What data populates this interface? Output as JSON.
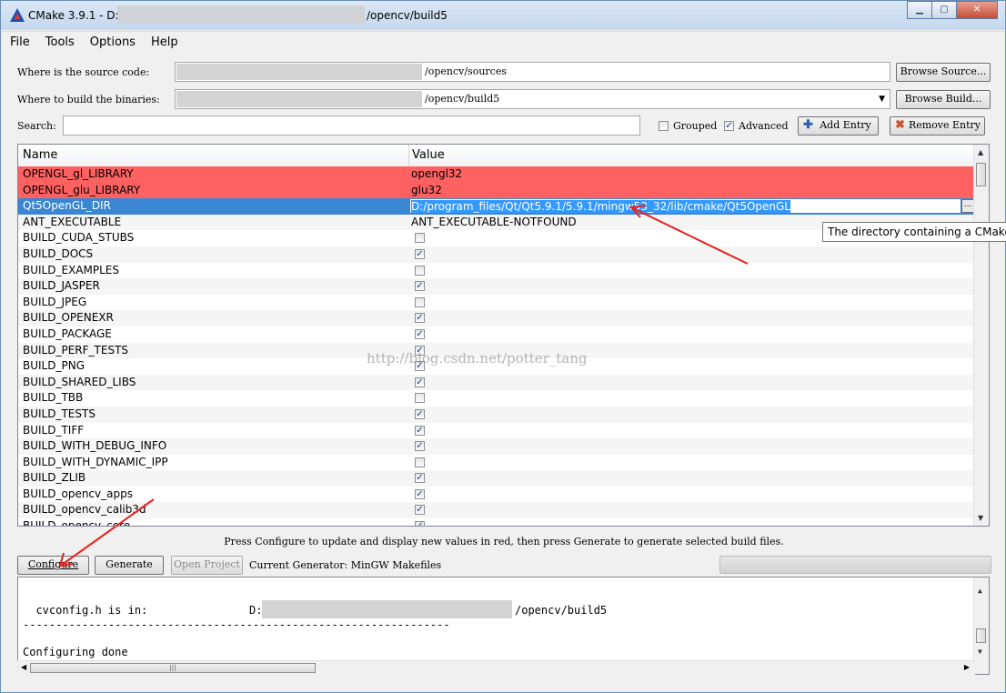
{
  "window": {
    "title_prefix": "CMake 3.9.1 - D:",
    "title_suffix": "/opencv/build5",
    "min_glyph": "▁",
    "max_glyph": "▢",
    "close_glyph": "✕"
  },
  "menu": [
    "File",
    "Tools",
    "Options",
    "Help"
  ],
  "source": {
    "label": "Where is the source code:",
    "value_suffix": "/opencv/sources",
    "browse_label": "Browse Source..."
  },
  "build": {
    "label": "Where to build the binaries:",
    "value_suffix": "/opencv/build5",
    "dropdown_glyph": "▼",
    "browse_label": "Browse Build..."
  },
  "search": {
    "label": "Search:",
    "value": ""
  },
  "options": {
    "grouped_label": "Grouped",
    "grouped_checked": false,
    "advanced_label": "Advanced",
    "advanced_checked": true,
    "add_entry_label": "Add Entry",
    "remove_entry_label": "Remove Entry"
  },
  "table": {
    "col_name": "Name",
    "col_value": "Value",
    "rows": [
      {
        "name": "OPENGL_gl_LIBRARY",
        "value": "opengl32",
        "state": "red"
      },
      {
        "name": "OPENGL_glu_LIBRARY",
        "value": "glu32",
        "state": "red"
      },
      {
        "name": "Qt5OpenGL_DIR",
        "value": "D:/program_files/Qt/Qt5.9.1/5.9.1/mingw53_32/lib/cmake/Qt5OpenGL",
        "state": "selected"
      },
      {
        "name": "ANT_EXECUTABLE",
        "value": "ANT_EXECUTABLE-NOTFOUND",
        "state": "normal"
      },
      {
        "name": "BUILD_CUDA_STUBS",
        "checked": false
      },
      {
        "name": "BUILD_DOCS",
        "checked": true
      },
      {
        "name": "BUILD_EXAMPLES",
        "checked": false
      },
      {
        "name": "BUILD_JASPER",
        "checked": true
      },
      {
        "name": "BUILD_JPEG",
        "checked": false
      },
      {
        "name": "BUILD_OPENEXR",
        "checked": true
      },
      {
        "name": "BUILD_PACKAGE",
        "checked": true
      },
      {
        "name": "BUILD_PERF_TESTS",
        "checked": true
      },
      {
        "name": "BUILD_PNG",
        "checked": true
      },
      {
        "name": "BUILD_SHARED_LIBS",
        "checked": true
      },
      {
        "name": "BUILD_TBB",
        "checked": false
      },
      {
        "name": "BUILD_TESTS",
        "checked": true
      },
      {
        "name": "BUILD_TIFF",
        "checked": true
      },
      {
        "name": "BUILD_WITH_DEBUG_INFO",
        "checked": true
      },
      {
        "name": "BUILD_WITH_DYNAMIC_IPP",
        "checked": false
      },
      {
        "name": "BUILD_ZLIB",
        "checked": true
      },
      {
        "name": "BUILD_opencv_apps",
        "checked": true
      },
      {
        "name": "BUILD_opencv_calib3d",
        "checked": true
      },
      {
        "name": "BUILD_opencv_core",
        "checked": true
      }
    ],
    "dots_label": "..."
  },
  "tooltip": "The directory containing a CMake",
  "status_message": "Press Configure to update and display new values in red, then press Generate to generate selected build files.",
  "actions": {
    "configure_label": "Configure",
    "generate_label": "Generate",
    "open_project_label": "Open Project",
    "current_generator": "Current Generator: MinGW Makefiles"
  },
  "output": {
    "line1": "  cvconfig.h is in:",
    "line1_path_prefix": "D:/",
    "line1_path_suffix": "/opencv/build5",
    "separator": "-----------------------------------------------------------------",
    "line2": "Configuring done"
  },
  "watermark": "http://blog.csdn.net/potter_tang",
  "colors": {
    "changed_row": "#fd6161",
    "selected_row": "#3b86d3",
    "annotation_arrow": "#e8201c"
  }
}
